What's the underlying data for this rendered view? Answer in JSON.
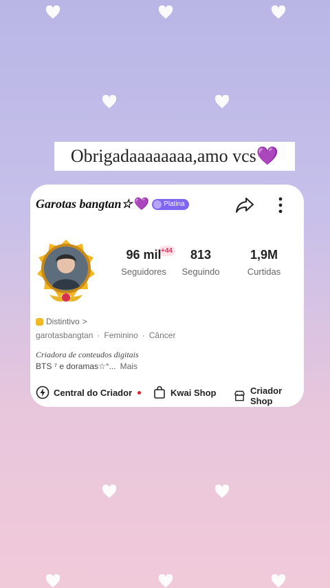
{
  "caption": "Obrigadaaaaaaaa,amo vcs💜",
  "profile": {
    "display_name": "Garotas bangtan☆",
    "display_heart": "💜",
    "tier_badge": "Platina",
    "stats": [
      {
        "value": "96 mil",
        "label": "Seguidores"
      },
      {
        "value": "813",
        "label": "Seguindo"
      },
      {
        "value": "1,9M",
        "label": "Curtidas"
      }
    ],
    "new_badge": "+44",
    "distintivo": "Distintivo",
    "distintivo_chevron": ">",
    "username": "garotasbangtan",
    "gender": "Feminino",
    "sign": "Câncer",
    "separator": "·",
    "bio_line1": "Criadora de conteudos digitais",
    "bio_line2": "BTS ⁷ e doramas☆°...",
    "more_label": "Mais"
  },
  "actions": [
    {
      "label": "Central do Criador",
      "icon": "lightning-circle-icon"
    },
    {
      "label": "Kwai Shop",
      "icon": "shopping-bag-icon"
    },
    {
      "label": "Criador Shop",
      "icon": "storefront-icon"
    }
  ]
}
